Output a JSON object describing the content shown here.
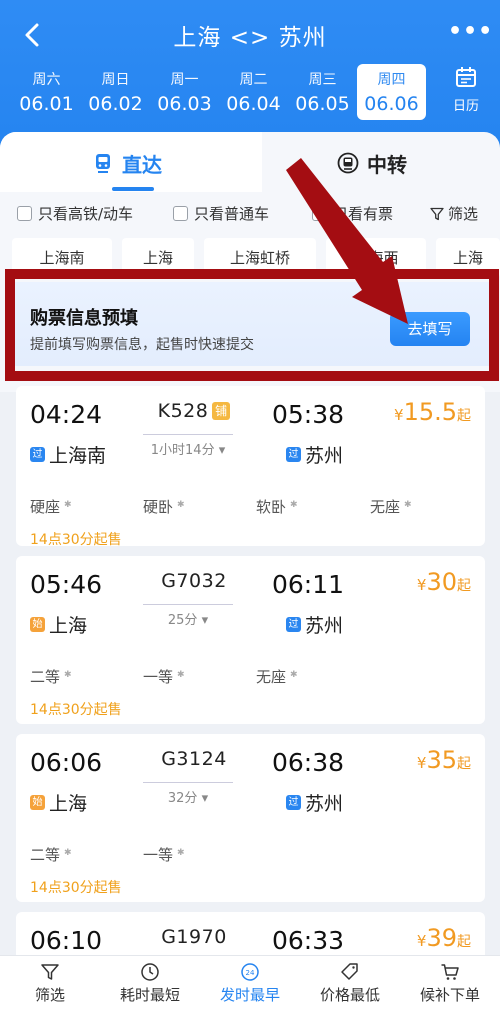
{
  "header": {
    "title": "上海 <> 苏州",
    "dates": [
      {
        "weekday": "周六",
        "date": "06.01",
        "active": false
      },
      {
        "weekday": "周日",
        "date": "06.02",
        "active": false
      },
      {
        "weekday": "周一",
        "date": "06.03",
        "active": false
      },
      {
        "weekday": "周二",
        "date": "06.04",
        "active": false
      },
      {
        "weekday": "周三",
        "date": "06.05",
        "active": false
      },
      {
        "weekday": "周四",
        "date": "06.06",
        "active": true
      }
    ],
    "calendar_label": "日历"
  },
  "tabs": {
    "direct": "直达",
    "transfer": "中转"
  },
  "filters": {
    "high_speed": "只看高铁/动车",
    "normal": "只看普通车",
    "available": "只看有票",
    "filter": "筛选"
  },
  "stations": [
    "上海南",
    "上海",
    "上海虹桥",
    "上海西",
    "上海"
  ],
  "promo": {
    "title": "购票信息预填",
    "subtitle": "提前填写购票信息，起售时快速提交",
    "button": "去填写"
  },
  "trains": [
    {
      "dep_time": "04:24",
      "arr_time": "05:38",
      "train_no": "K528",
      "sleeper_tag": "铺",
      "duration": "1小时14分",
      "dep_station": "上海南",
      "dep_badge": "过",
      "arr_station": "苏州",
      "arr_badge": "过",
      "price_currency": "¥",
      "price": "15.5",
      "price_suffix": "起",
      "seats": [
        "硬座",
        "硬卧",
        "软卧",
        "无座"
      ],
      "sale_time": "14点30分起售"
    },
    {
      "dep_time": "05:46",
      "arr_time": "06:11",
      "train_no": "G7032",
      "duration": "25分",
      "dep_station": "上海",
      "dep_badge": "始",
      "arr_station": "苏州",
      "arr_badge": "过",
      "price_currency": "¥",
      "price": "30",
      "price_suffix": "起",
      "seats": [
        "二等",
        "一等",
        "无座"
      ],
      "sale_time": "14点30分起售"
    },
    {
      "dep_time": "06:06",
      "arr_time": "06:38",
      "train_no": "G3124",
      "duration": "32分",
      "dep_station": "上海",
      "dep_badge": "始",
      "arr_station": "苏州",
      "arr_badge": "过",
      "price_currency": "¥",
      "price": "35",
      "price_suffix": "起",
      "seats": [
        "二等",
        "一等"
      ],
      "sale_time": "14点30分起售"
    },
    {
      "dep_time": "06:10",
      "arr_time": "06:33",
      "train_no": "G1970",
      "price_currency": "¥",
      "price": "39",
      "price_suffix": "起"
    }
  ],
  "bottom_bar": [
    {
      "label": "筛选",
      "icon": "filter-icon",
      "active": false
    },
    {
      "label": "耗时最短",
      "icon": "clock-icon",
      "active": false
    },
    {
      "label": "发时最早",
      "icon": "24h-icon",
      "icon_text": "24",
      "active": true
    },
    {
      "label": "价格最低",
      "icon": "price-tag-icon",
      "active": false
    },
    {
      "label": "候补下单",
      "icon": "cart-icon",
      "active": false
    }
  ],
  "colors": {
    "primary": "#2584f0",
    "price": "#f19a22",
    "annotation": "#a40d12"
  }
}
